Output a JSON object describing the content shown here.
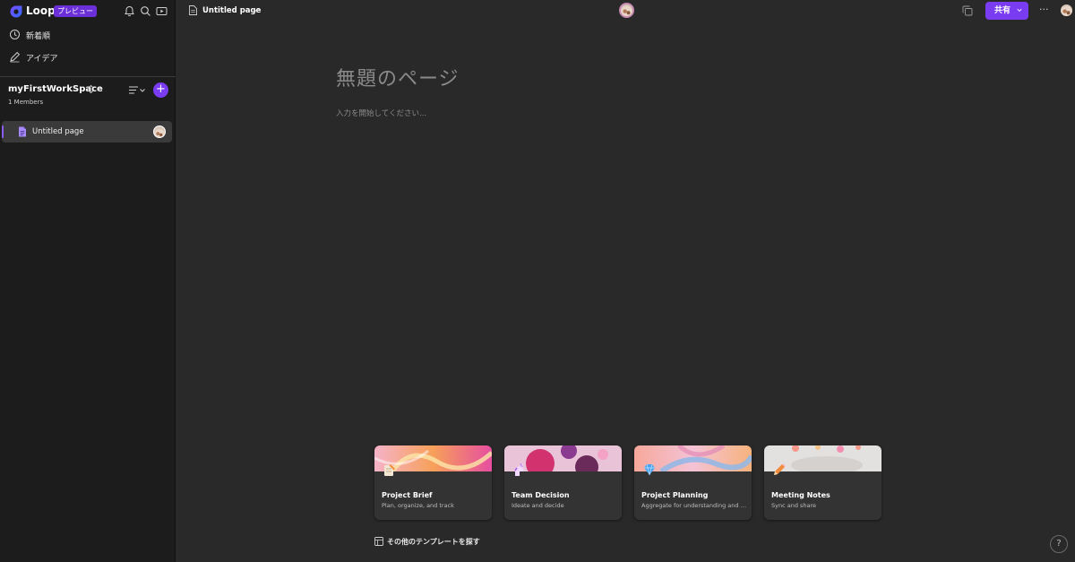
{
  "app": {
    "name": "Loop",
    "badge": "プレビュー"
  },
  "sidebar": {
    "nav": [
      {
        "label": "新着順",
        "icon": "clock-icon"
      },
      {
        "label": "アイデア",
        "icon": "pen-icon"
      }
    ],
    "workspace": {
      "name": "myFirstWorkSpace",
      "members": "1 Members",
      "add_label": "+"
    },
    "pages": [
      {
        "label": "Untitled page"
      }
    ]
  },
  "header": {
    "title": "Untitled page",
    "share_label": "共有",
    "more_label": "···"
  },
  "main": {
    "heading_placeholder": "無題のページ",
    "body_placeholder": "入力を開始してください...",
    "templates": [
      {
        "name": "Project Brief",
        "desc": "Plan, organize, and track",
        "icon": "notebook-pencil-icon"
      },
      {
        "name": "Team Decision",
        "desc": "Ideate and decide",
        "icon": "unicorn-icon"
      },
      {
        "name": "Project Planning",
        "desc": "Aggregate for understanding and alignment",
        "icon": "gem-icon"
      },
      {
        "name": "Meeting Notes",
        "desc": "Sync and share",
        "icon": "pencil-icon"
      }
    ],
    "more_templates_label": "その他のテンプレートを探す",
    "help_label": "?"
  },
  "colors": {
    "accent": "#7a3cf0",
    "sidebar_bg": "#1c1c1c",
    "main_bg": "#292929",
    "card_bg": "#333333"
  }
}
